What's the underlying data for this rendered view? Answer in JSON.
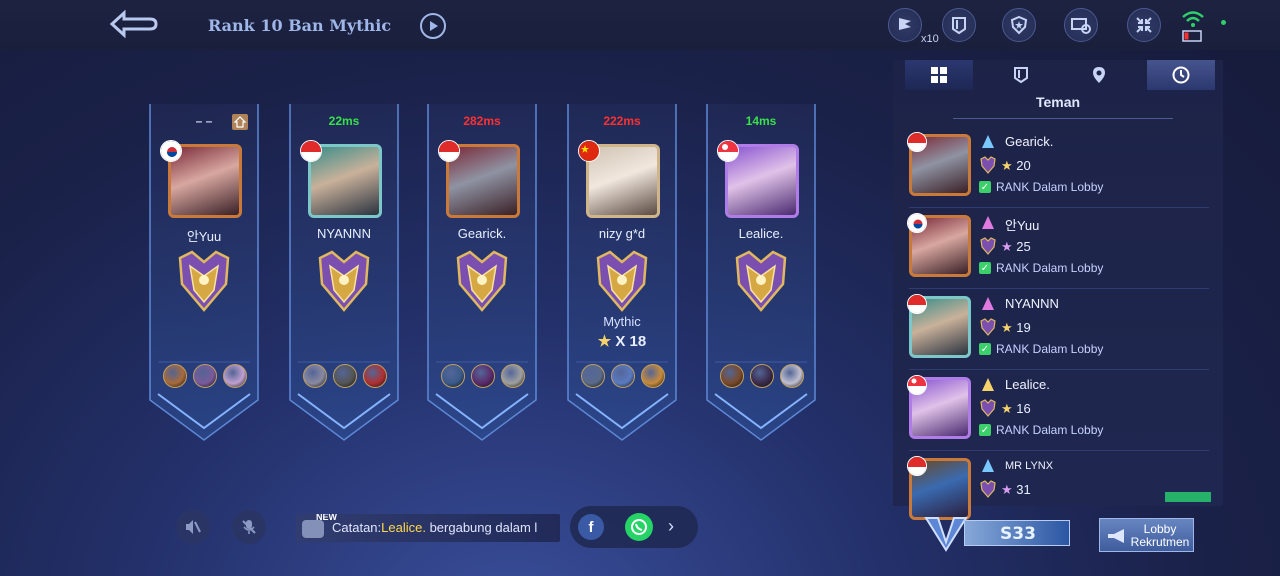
{
  "header": {
    "title": "Rank 10 Ban Mythic",
    "x10_label": "x10"
  },
  "players": [
    {
      "ping": "– –",
      "ping_color": "#cfd6ee",
      "name": "안Yuu",
      "flag": "kr",
      "rank": "mythic",
      "heroes": [
        "hero-1",
        "hero-2",
        "hero-3"
      ]
    },
    {
      "ping": "22ms",
      "ping_color": "#38e04b",
      "name": "NYANNN",
      "flag": "id",
      "rank": "mythic",
      "heroes": [
        "hero-1",
        "hero-2",
        "hero-3"
      ]
    },
    {
      "ping": "282ms",
      "ping_color": "#ff3030",
      "name": "Gearick.",
      "flag": "id",
      "rank": "mythic",
      "heroes": [
        "hero-1",
        "hero-2",
        "hero-3"
      ]
    },
    {
      "ping": "222ms",
      "ping_color": "#ff3030",
      "name": "nizy g*d",
      "flag": "cn",
      "rank": "mythic",
      "rank_label": "Mythic",
      "stars_label": "X 18",
      "heroes": [
        "hero-1",
        "hero-2",
        "hero-3"
      ]
    },
    {
      "ping": "14ms",
      "ping_color": "#38e04b",
      "name": "Lealice.",
      "flag": "sg",
      "rank": "mythic",
      "heroes": [
        "hero-1",
        "hero-2",
        "hero-3"
      ]
    }
  ],
  "friends_panel": {
    "tab_label": "Teman",
    "friends": [
      {
        "name": "Gearick.",
        "flag": "id",
        "stars": "20",
        "status": "RANK Dalam Lobby"
      },
      {
        "name": "안Yuu",
        "flag": "kr",
        "stars": "25",
        "status": "RANK Dalam Lobby"
      },
      {
        "name": "NYANNN",
        "flag": "id",
        "stars": "19",
        "status": "RANK Dalam Lobby"
      },
      {
        "name": "Lealice.",
        "flag": "sg",
        "stars": "16",
        "status": "RANK Dalam Lobby"
      },
      {
        "name": "MR LYNX",
        "flag": "id",
        "stars": "31",
        "status": ""
      }
    ]
  },
  "chat": {
    "new_badge": "NEW",
    "prefix": "Catatan:",
    "highlight": "Lealice.",
    "suffix": " bergabung dalam l"
  },
  "share": {
    "fb_label": "f"
  },
  "season": {
    "label": "S33"
  },
  "lobby_button": {
    "label": "Lobby Rekrutmen"
  },
  "colors": {
    "accent": "#9fb6e8",
    "ping_good": "#38e04b",
    "ping_bad": "#ff3030",
    "status_green": "#3bd06a"
  }
}
